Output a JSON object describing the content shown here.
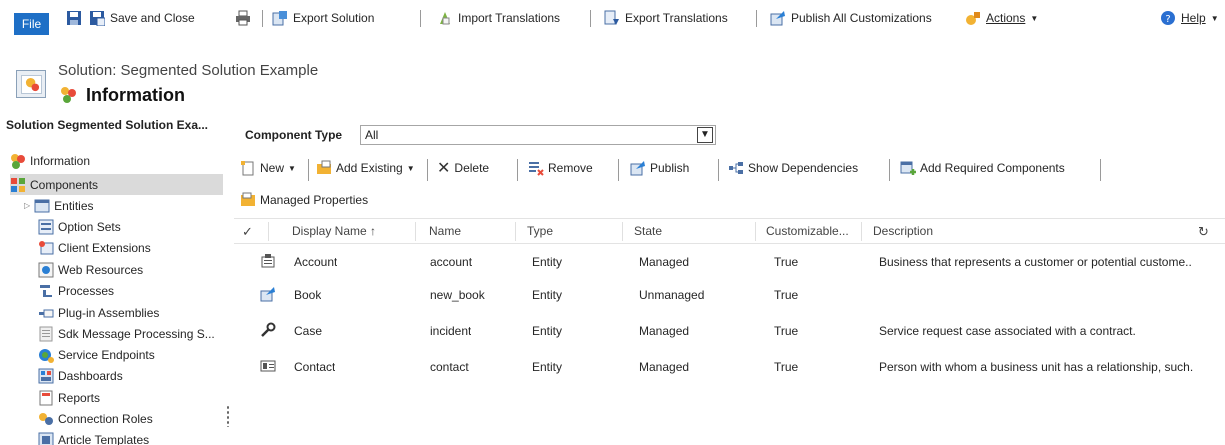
{
  "ribbon": {
    "file_label": "File",
    "save_close_label": "Save and Close",
    "export_solution_label": "Export Solution",
    "import_translations_label": "Import Translations",
    "export_translations_label": "Export Translations",
    "publish_all_label": "Publish All Customizations",
    "actions_label": "Actions",
    "help_label": "Help"
  },
  "header": {
    "subtitle": "Solution: Segmented Solution Example",
    "title": "Information"
  },
  "nav": {
    "title": "Solution Segmented Solution Exa...",
    "items": [
      {
        "label": "Information",
        "icon": "information-icon"
      },
      {
        "label": "Components",
        "icon": "components-icon"
      },
      {
        "label": "Entities",
        "icon": "entities-icon"
      },
      {
        "label": "Option Sets",
        "icon": "option-sets-icon"
      },
      {
        "label": "Client Extensions",
        "icon": "client-extensions-icon"
      },
      {
        "label": "Web Resources",
        "icon": "web-resources-icon"
      },
      {
        "label": "Processes",
        "icon": "processes-icon"
      },
      {
        "label": "Plug-in Assemblies",
        "icon": "plugin-assemblies-icon"
      },
      {
        "label": "Sdk Message Processing S...",
        "icon": "sdk-message-icon"
      },
      {
        "label": "Service Endpoints",
        "icon": "service-endpoints-icon"
      },
      {
        "label": "Dashboards",
        "icon": "dashboards-icon"
      },
      {
        "label": "Reports",
        "icon": "reports-icon"
      },
      {
        "label": "Connection Roles",
        "icon": "connection-roles-icon"
      },
      {
        "label": "Article Templates",
        "icon": "article-templates-icon"
      }
    ]
  },
  "filter": {
    "label": "Component Type",
    "value": "All"
  },
  "grid_toolbar": {
    "new_label": "New",
    "add_existing_label": "Add Existing",
    "delete_label": "Delete",
    "remove_label": "Remove",
    "publish_label": "Publish",
    "show_dependencies_label": "Show Dependencies",
    "add_required_label": "Add Required Components",
    "managed_properties_label": "Managed Properties"
  },
  "table": {
    "columns": [
      "Display Name ↑",
      "Name",
      "Type",
      "State",
      "Customizable...",
      "Description"
    ],
    "rows": [
      {
        "display_name": "Account",
        "name": "account",
        "type": "Entity",
        "state": "Managed",
        "customizable": "True",
        "description": "Business that represents a customer or potential custome..",
        "icon": "account-icon"
      },
      {
        "display_name": "Book",
        "name": "new_book",
        "type": "Entity",
        "state": "Unmanaged",
        "customizable": "True",
        "description": "",
        "icon": "book-entity-icon"
      },
      {
        "display_name": "Case",
        "name": "incident",
        "type": "Entity",
        "state": "Managed",
        "customizable": "True",
        "description": "Service request case associated with a contract.",
        "icon": "case-icon"
      },
      {
        "display_name": "Contact",
        "name": "contact",
        "type": "Entity",
        "state": "Managed",
        "customizable": "True",
        "description": "Person with whom a business unit has a relationship, such.",
        "icon": "contact-icon"
      }
    ]
  },
  "colors": {
    "file_button": "#1e6fc6",
    "selected_nav": "#dadada",
    "separator": "#9a9a9a"
  }
}
